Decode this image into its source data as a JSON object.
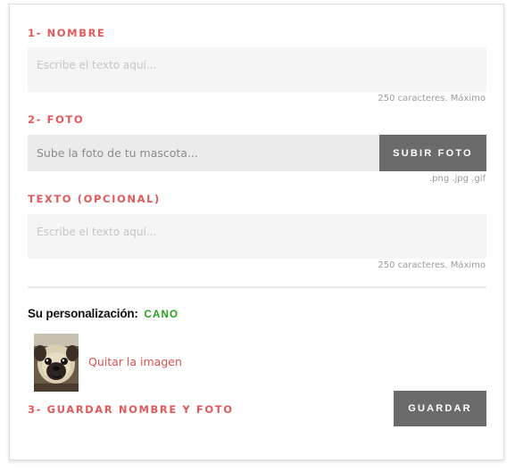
{
  "form": {
    "name_section": {
      "label": "1- NOMBRE",
      "placeholder": "Escribe el texto aquí...",
      "hint": "250 caracteres. Máximo"
    },
    "photo_section": {
      "label": "2- FOTO",
      "placeholder": "Sube la foto de tu mascota...",
      "upload_button": "SUBIR FOTO",
      "hint": ".png .jpg .gif"
    },
    "text_section": {
      "label": "TEXTO (OPCIONAL)",
      "placeholder": "Escribe el texto aquí...",
      "hint": "250 caracteres. Máximo"
    },
    "personalization": {
      "label": "Su personalización:",
      "value": "CANO",
      "thumbnail_icon": "pug-photo",
      "remove_link": "Quitar la imagen"
    },
    "save_section": {
      "label": "3- GUARDAR NOMBRE Y FOTO",
      "save_button": "GUARDAR"
    }
  },
  "colors": {
    "accent_red": "#e05a5a",
    "value_green": "#22a21d",
    "button_gray": "#6b6b6b",
    "field_bg": "#f5f5f5"
  }
}
